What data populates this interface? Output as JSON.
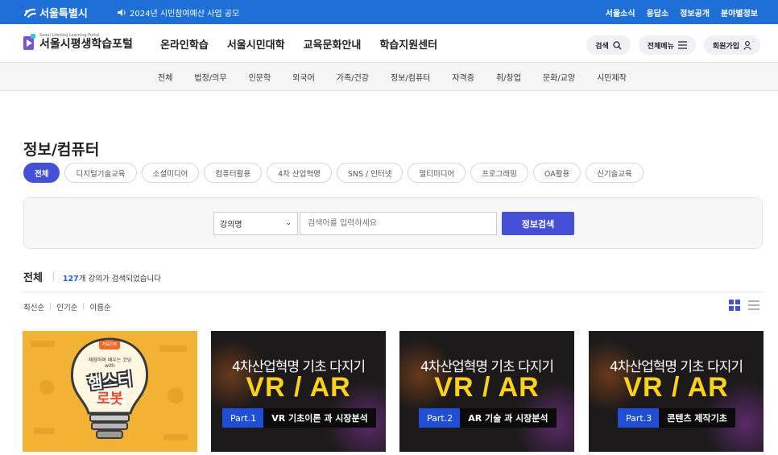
{
  "topbar": {
    "brand": "서울특별시",
    "notice": "2024년 시민참여예산 사업 공모",
    "links": [
      "서울소식",
      "응답소",
      "정보공개",
      "분야별정보"
    ]
  },
  "header": {
    "logo_sub": "Seoul Lifelong Learning Portal",
    "logo_name": "서울시평생학습포털",
    "gnb": [
      "온라인학습",
      "서울시민대학",
      "교육문화안내",
      "학습지원센터"
    ],
    "buttons": [
      "검색",
      "전체메뉴",
      "회원가입"
    ]
  },
  "categories": [
    "전체",
    "법정/의무",
    "인문학",
    "외국어",
    "가족/건강",
    "정보/컴퓨터",
    "자격증",
    "취/창업",
    "문화/교양",
    "시민제작"
  ],
  "page_title": "정보/컴퓨터",
  "chips": [
    "전체",
    "디지털기술교육",
    "소셜미디어",
    "컴퓨터활용",
    "4차 산업혁명",
    "SNS / 인터넷",
    "멀티미디어",
    "프로그래밍",
    "OA활용",
    "신기술교육"
  ],
  "search": {
    "select_value": "강의명",
    "placeholder": "검색어를 입력하세요",
    "button": "정보검색"
  },
  "results": {
    "title": "전체",
    "count": "127",
    "count_suffix": "개 강의가 검색되었습니다",
    "sorts": [
      "최신순",
      "인기순",
      "이름순"
    ]
  },
  "cards": [
    {
      "badge": "처음으로",
      "line1": "체험하며 배우는 코딩",
      "with": "with",
      "title1": "햄스터",
      "title2": "로봇"
    },
    {
      "sub": "4차산업혁명 기초 다지기",
      "main": "VR / AR",
      "part": "Part.1",
      "desc": "VR 기초이론 과 시장분석"
    },
    {
      "sub": "4차산업혁명 기초 다지기",
      "main": "VR / AR",
      "part": "Part.2",
      "desc": "AR 기술 과 시장분석"
    },
    {
      "sub": "4차산업혁명 기초 다지기",
      "main": "VR / AR",
      "part": "Part.3",
      "desc": "콘텐츠 제작기초"
    }
  ],
  "colors": {
    "primary": "#4450d8",
    "topbar": "#1f6fd8"
  }
}
